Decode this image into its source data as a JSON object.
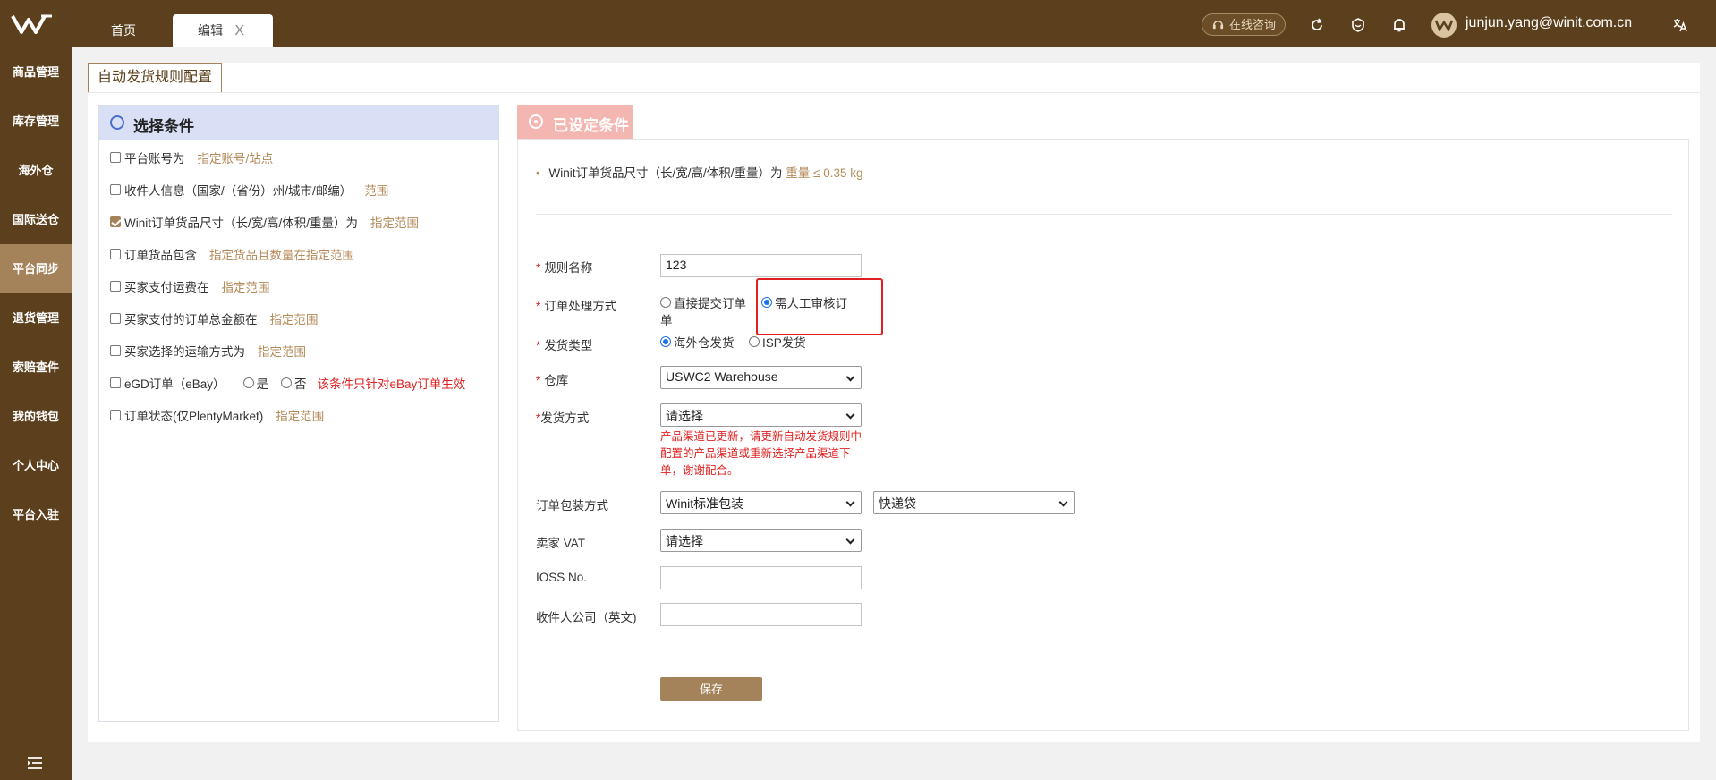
{
  "topbar": {
    "tabs": [
      {
        "label": "首页"
      },
      {
        "label": "编辑",
        "close": "X"
      }
    ],
    "consult_label": "在线咨询",
    "user_email": "junjun.yang@winit.com.cn"
  },
  "sidebar": {
    "items": [
      {
        "label": "商品管理"
      },
      {
        "label": "库存管理"
      },
      {
        "label": "海外仓"
      },
      {
        "label": "国际送仓"
      },
      {
        "label": "平台同步",
        "active": true
      },
      {
        "label": "退货管理"
      },
      {
        "label": "索赔查件"
      },
      {
        "label": "我的钱包"
      },
      {
        "label": "个人中心"
      },
      {
        "label": "平台入驻"
      }
    ]
  },
  "page": {
    "tab_title": "自动发货规则配置"
  },
  "left_panel": {
    "title": "选择条件",
    "conditions": [
      {
        "label": "平台账号为",
        "link": "指定账号/站点",
        "checked": false
      },
      {
        "label": "收件人信息（国家/（省份）州/城市/邮编）",
        "link": "范围",
        "checked": false
      },
      {
        "label": "Winit订单货品尺寸（长/宽/高/体积/重量）为",
        "link": "指定范围",
        "checked": true
      },
      {
        "label": "订单货品包含",
        "link": "指定货品且数量在指定范围",
        "checked": false
      },
      {
        "label": "买家支付运费在",
        "link": "指定范围",
        "checked": false
      },
      {
        "label": "买家支付的订单总金额在",
        "link": "指定范围",
        "checked": false
      },
      {
        "label": "买家选择的运输方式为",
        "link": "指定范围",
        "checked": false
      },
      {
        "label": "eGD订单（eBay）",
        "yes": "是",
        "no": "否",
        "note": "该条件只针对eBay订单生效",
        "checked": false
      },
      {
        "label": "订单状态(仅PlentyMarket)",
        "link": "指定范围",
        "checked": false
      }
    ]
  },
  "right_panel": {
    "title": "已设定条件",
    "set_condition": {
      "prefix": "Winit订单货品尺寸（长/宽/高/体积/重量）为",
      "value": "重量 ≤ 0.35 kg"
    },
    "form": {
      "rule_name": {
        "label": "规则名称",
        "value": "123"
      },
      "process": {
        "label": "订单处理方式",
        "opt1": "直接提交订单",
        "opt1_wrap": "单",
        "opt2": "需人工审核订",
        "selected": "opt2"
      },
      "ship_type": {
        "label": "发货类型",
        "opt1": "海外仓发货",
        "opt2": "ISP发货",
        "selected": "opt1"
      },
      "warehouse": {
        "label": "仓库",
        "value": "USWC2 Warehouse"
      },
      "ship_method": {
        "label": "发货方式",
        "value": "请选择",
        "error": "产品渠道已更新，请更新自动发货规则中配置的产品渠道或重新选择产品渠道下单，谢谢配合。"
      },
      "packaging": {
        "label": "订单包装方式",
        "value1": "Winit标准包装",
        "value2": "快递袋"
      },
      "vat": {
        "label": "卖家 VAT",
        "value": "请选择"
      },
      "ioss": {
        "label": "IOSS No.",
        "value": ""
      },
      "company": {
        "label": "收件人公司（英文)",
        "value": ""
      },
      "save_label": "保存"
    }
  },
  "colors": {
    "brand": "#5c3f1c",
    "accent": "#a5835a",
    "error": "#e02020",
    "left_header": "#d9dff5",
    "right_header": "#f4b6b0"
  }
}
